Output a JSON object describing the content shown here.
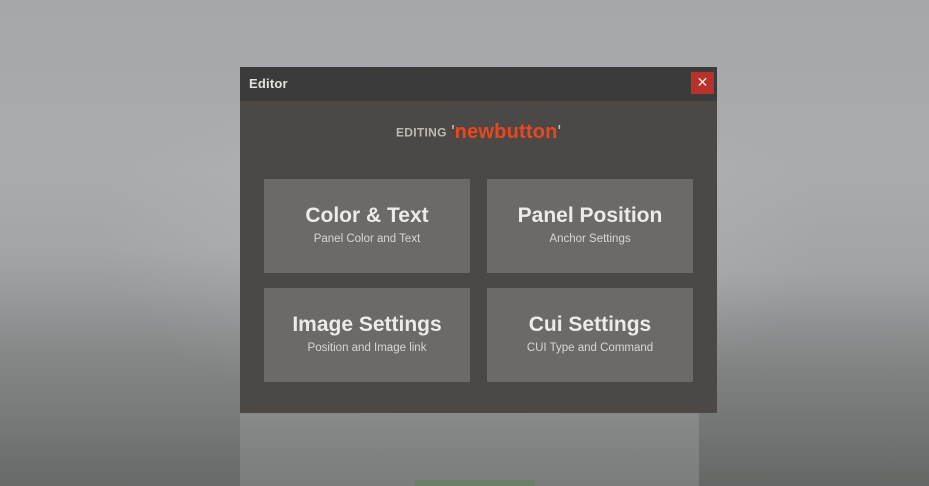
{
  "window": {
    "title": "Editor",
    "close_glyph": "✕",
    "close_icon": "close-icon"
  },
  "editing": {
    "label": "EDITING",
    "open_quote": "'",
    "name": "newbutton",
    "close_quote": "'"
  },
  "tiles": [
    {
      "title": "Color & Text",
      "subtitle": "Panel Color and Text"
    },
    {
      "title": "Panel Position",
      "subtitle": "Anchor Settings"
    },
    {
      "title": "Image Settings",
      "subtitle": "Position and Image link"
    },
    {
      "title": "Cui Settings",
      "subtitle": "CUI Type and Command"
    }
  ],
  "colors": {
    "accent_name": "#e8481f",
    "close_button": "#b8312a",
    "panel": "#4c4846",
    "titlebar": "#3b3b3b",
    "tile": "#6c6a68"
  }
}
